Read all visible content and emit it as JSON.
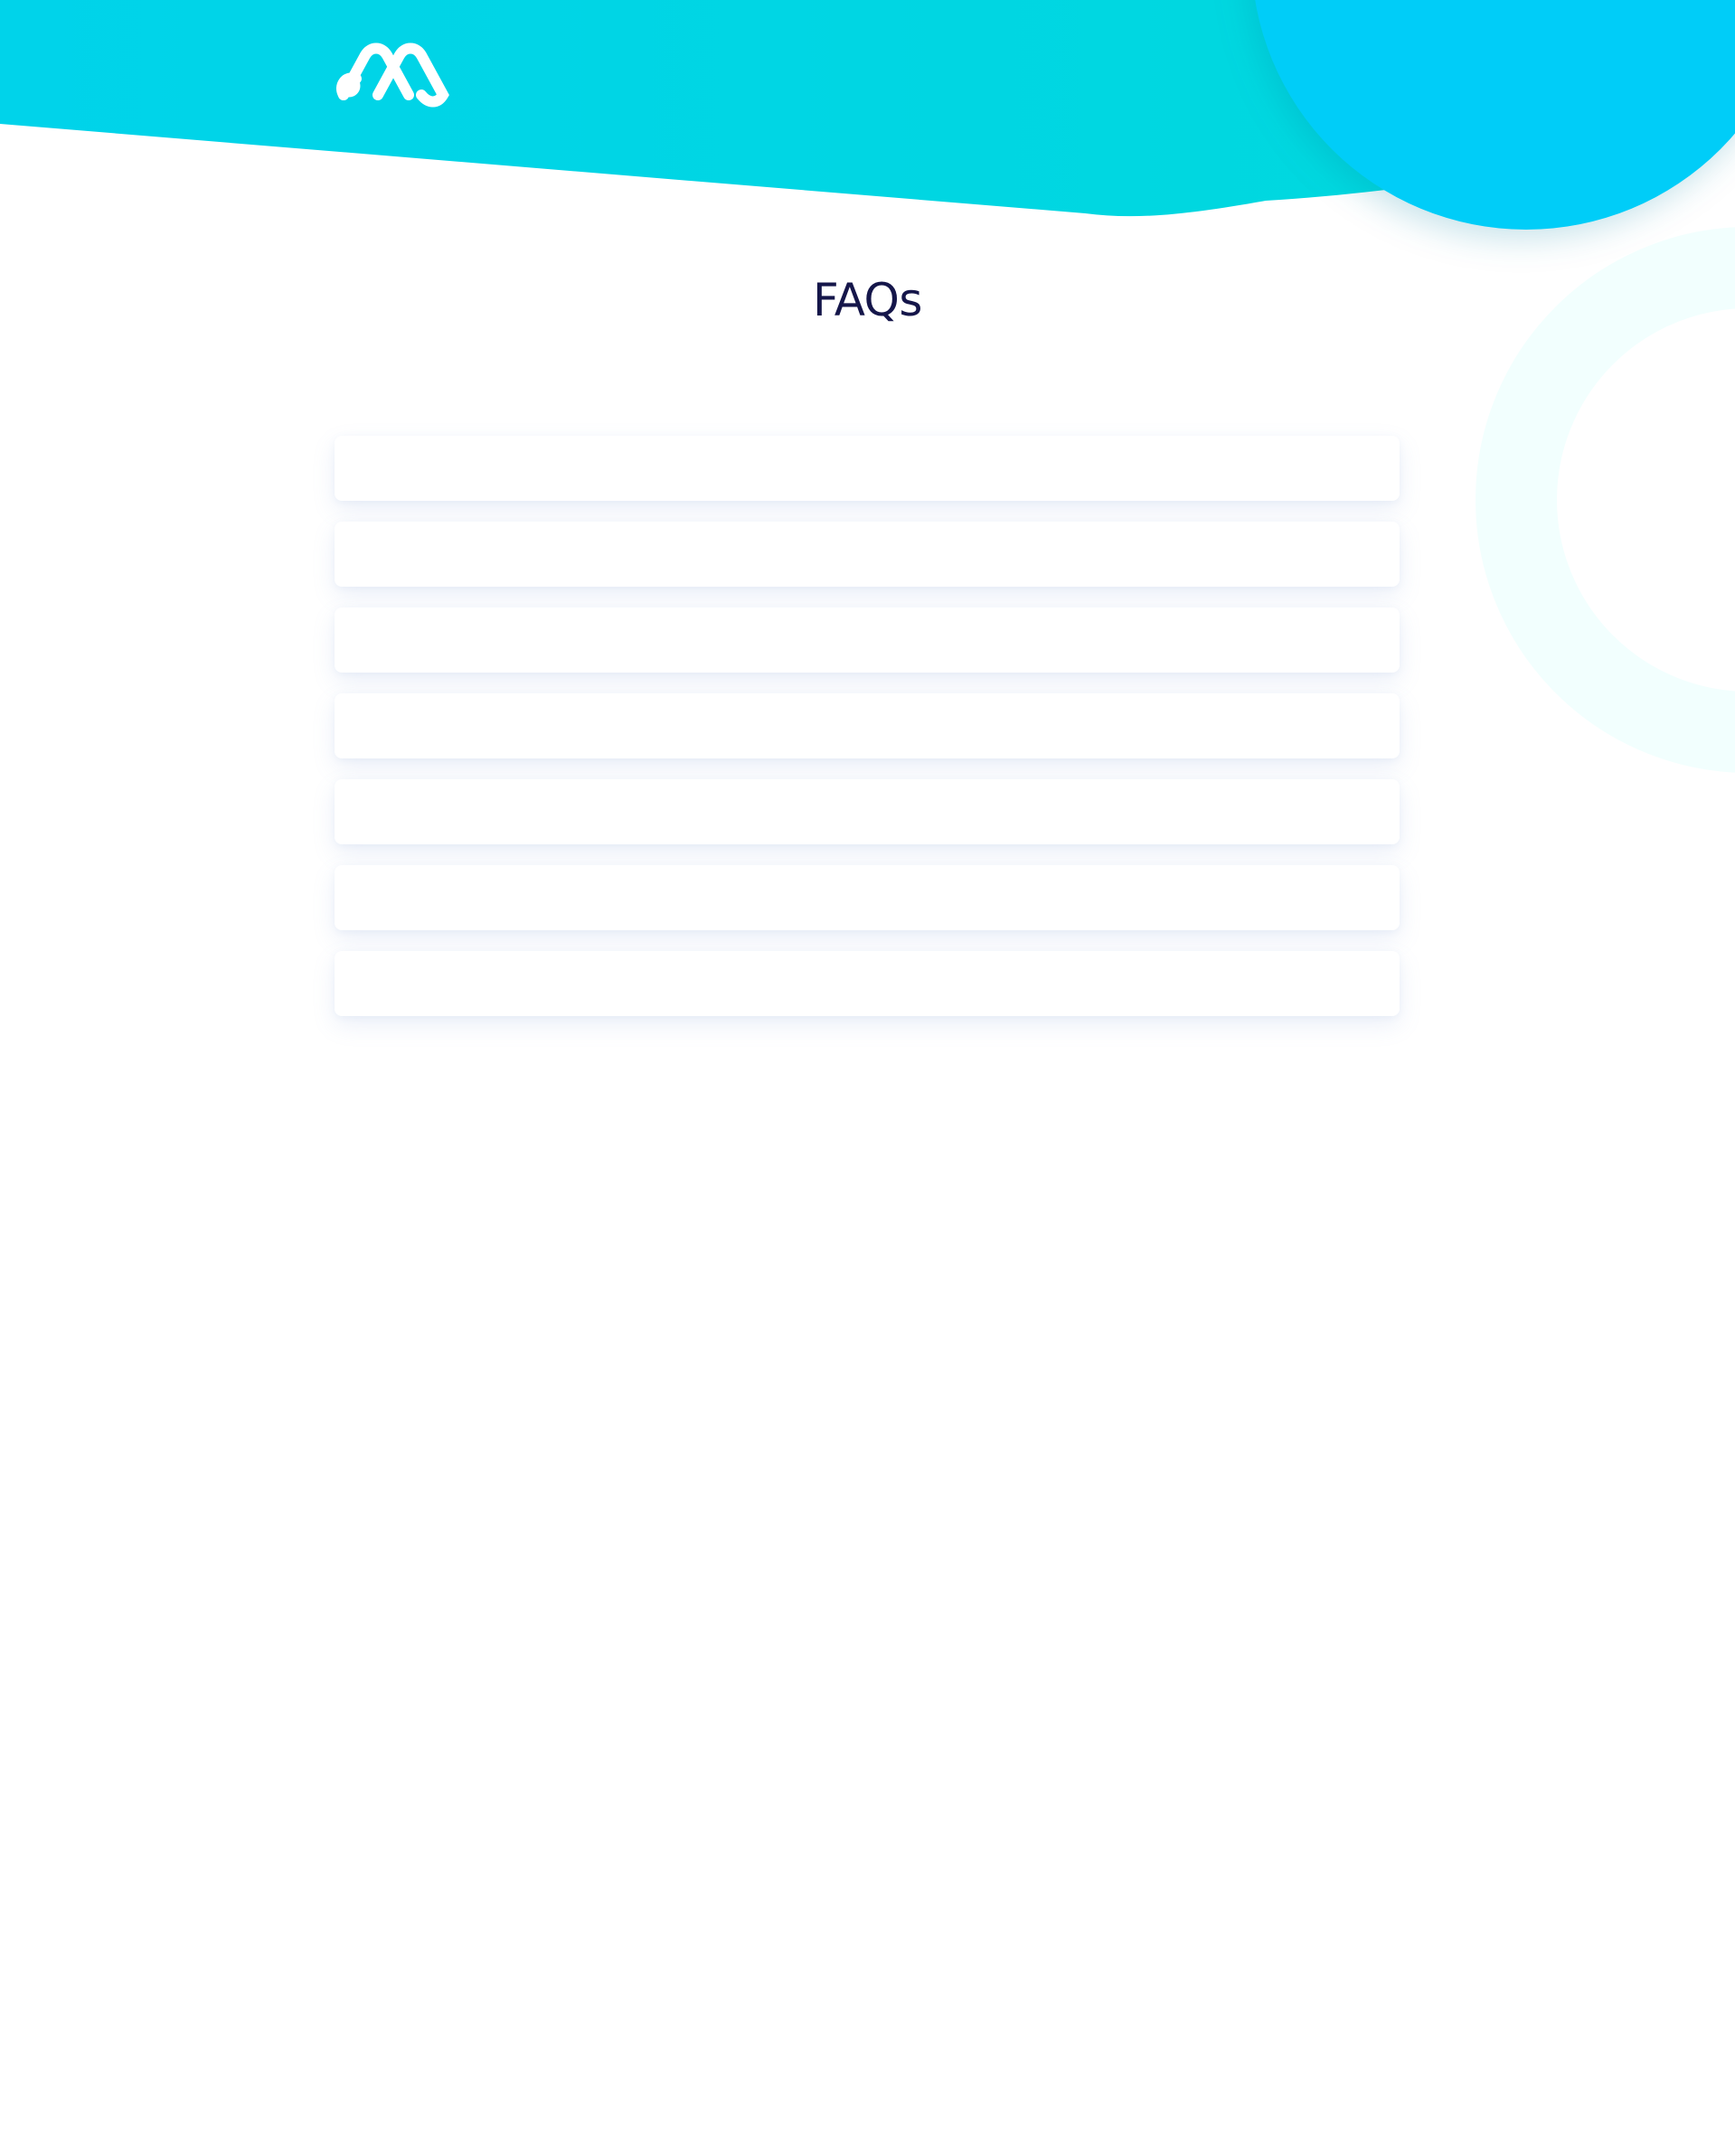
{
  "header": {
    "logo": {
      "icon": "linked-loops-logo-icon"
    }
  },
  "page": {
    "title": "FAQs"
  },
  "faq": {
    "items": [
      {
        "question": ""
      },
      {
        "question": ""
      },
      {
        "question": ""
      },
      {
        "question": ""
      },
      {
        "question": ""
      },
      {
        "question": ""
      },
      {
        "question": ""
      }
    ]
  },
  "colors": {
    "wave_start": "#00d3ea",
    "wave_end": "#00d9dc",
    "circle": "#00cdf8",
    "ring": "#f2fffe",
    "title": "#15164a"
  }
}
